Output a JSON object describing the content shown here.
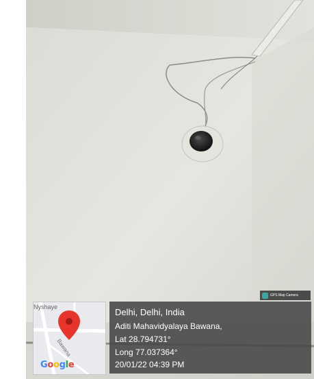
{
  "map": {
    "google_logo": "Google",
    "place_partial": "Nyshaye",
    "road_label": "Bawana",
    "logo_colors": [
      "#4285F4",
      "#EA4335",
      "#FBBC05",
      "#4285F4",
      "#34A853",
      "#EA4335"
    ]
  },
  "stamp": {
    "location": "Delhi, Delhi, India",
    "address": "Aditi Mahavidyalaya Bawana,",
    "latitude": "Lat 28.794731°",
    "longitude": "Long 77.037364°",
    "datetime": "20/01/22 04:39 PM"
  },
  "badge": {
    "label": "GPS Map Camera"
  }
}
